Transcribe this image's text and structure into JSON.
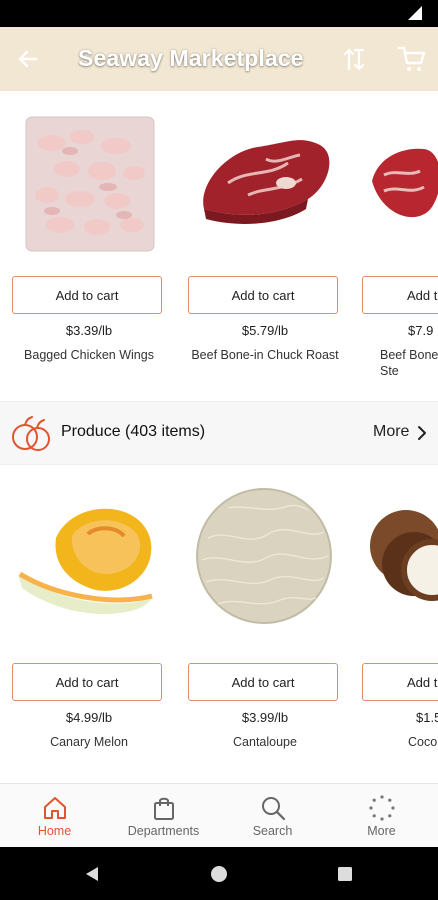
{
  "header": {
    "title": "Seaway Marketplace",
    "bg_color": "#f2e7d3"
  },
  "accent_color": "#e0552f",
  "meat_row": [
    {
      "button": "Add to cart",
      "price": "$3.39/lb",
      "name": "Bagged Chicken Wings",
      "icon": "bagged-chicken-image"
    },
    {
      "button": "Add to cart",
      "price": "$5.79/lb",
      "name": "Beef Bone-in Chuck Roast",
      "icon": "beef-chuck-image"
    },
    {
      "button": "Add t",
      "price": "$7.9",
      "name": "Beef Bone Ste",
      "icon": "beef-steak-image"
    }
  ],
  "produce_section": {
    "label": "Produce (403 items)",
    "more": "More"
  },
  "produce_row": [
    {
      "button": "Add to cart",
      "price": "$4.99/lb",
      "name": "Canary Melon",
      "icon": "canary-melon-image"
    },
    {
      "button": "Add to cart",
      "price": "$3.99/lb",
      "name": "Cantaloupe",
      "icon": "cantaloupe-image"
    },
    {
      "button": "Add t",
      "price": "$1.5",
      "name": "Coco",
      "icon": "coconut-image"
    }
  ],
  "bottom_nav": [
    {
      "label": "Home",
      "icon": "home-icon",
      "active": true
    },
    {
      "label": "Departments",
      "icon": "shopping-bag-icon",
      "active": false
    },
    {
      "label": "Search",
      "icon": "search-icon",
      "active": false
    },
    {
      "label": "More",
      "icon": "more-dots-icon",
      "active": false
    }
  ]
}
